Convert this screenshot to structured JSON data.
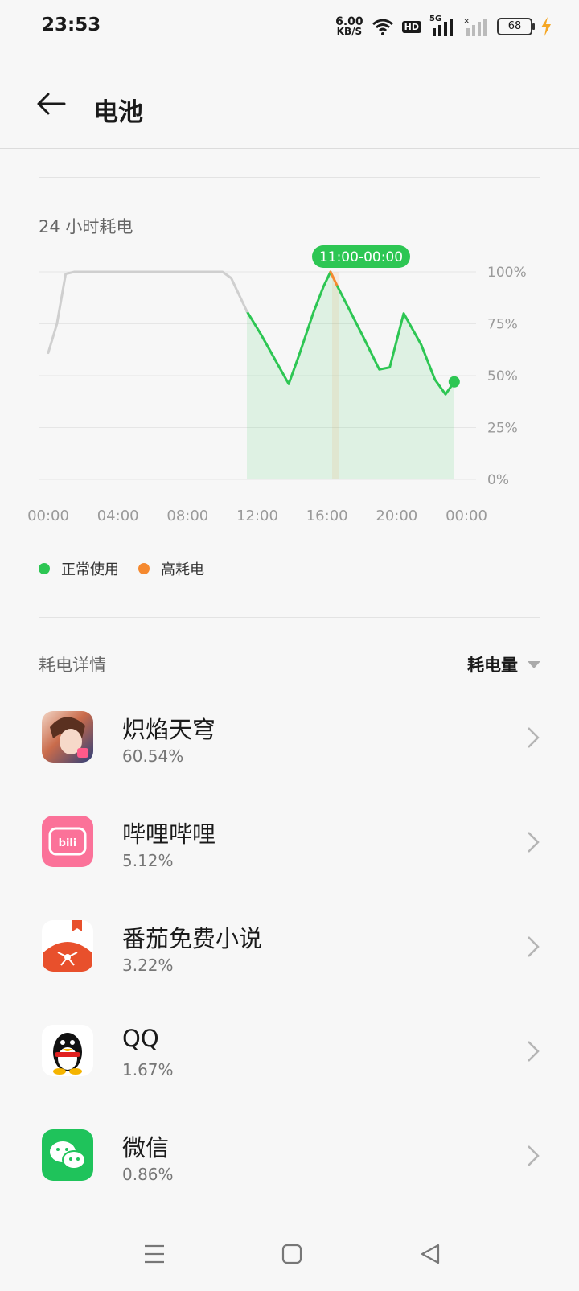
{
  "status_bar": {
    "time": "23:53",
    "net_speed_value": "6.00",
    "net_speed_unit": "KB/S",
    "hd_badge": "HD",
    "signal_label": "5G",
    "battery_level": "68"
  },
  "header": {
    "title": "电池"
  },
  "usage_section": {
    "title": "24 小时耗电",
    "selected_range": "11:00-00:00"
  },
  "chart_data": {
    "type": "line",
    "title": "24 小时耗电",
    "x_tick_labels": [
      "00:00",
      "04:00",
      "08:00",
      "12:00",
      "16:00",
      "20:00",
      "00:00"
    ],
    "y_tick_labels": [
      "100%",
      "75%",
      "50%",
      "25%",
      "0%"
    ],
    "ylim": [
      0,
      100
    ],
    "x_unit": "hours",
    "xlim": [
      0,
      24
    ],
    "grid": true,
    "series": [
      {
        "name": "正常使用",
        "color": "#2dc653",
        "x": [
          11.4,
          12.2,
          13.2,
          13.8,
          14.4,
          15.2,
          15.8,
          16.2
        ],
        "y": [
          81,
          70,
          55,
          46,
          60,
          80,
          93,
          100
        ]
      },
      {
        "name": "高耗电",
        "color": "#f5892f",
        "x": [
          16.2,
          16.6
        ],
        "y": [
          100,
          93
        ]
      },
      {
        "name": "正常使用",
        "color": "#2dc653",
        "x": [
          16.6,
          18.0,
          19.0,
          19.6,
          20.4,
          21.4,
          22.2,
          22.8,
          23.3
        ],
        "y": [
          93,
          70,
          53,
          54,
          80,
          65,
          48,
          41,
          47
        ]
      },
      {
        "name": "",
        "color": "#cfcfcf",
        "x": [
          0.0,
          0.5,
          1.0,
          1.5,
          2.0,
          8.0,
          9.0,
          10.0,
          10.5,
          11.4
        ],
        "y": [
          61,
          75,
          99,
          100,
          100,
          100,
          100,
          100,
          97,
          81
        ]
      }
    ]
  },
  "legend": [
    {
      "label": "正常使用",
      "color": "#2dc653"
    },
    {
      "label": "高耗电",
      "color": "#f5892f"
    }
  ],
  "details": {
    "title": "耗电详情",
    "sort_label": "耗电量",
    "apps": [
      {
        "name": "炽焰天穹",
        "percent": "60.54%"
      },
      {
        "name": "哔哩哔哩",
        "percent": "5.12%"
      },
      {
        "name": "番茄免费小说",
        "percent": "3.22%"
      },
      {
        "name": "QQ",
        "percent": "1.67%"
      },
      {
        "name": "微信",
        "percent": "0.86%"
      }
    ]
  },
  "icons": {
    "back": "back-arrow-icon",
    "wifi": "wifi-icon",
    "signal": "signal-icon",
    "battery": "battery-icon",
    "charging": "charging-bolt-icon",
    "chevron": "chevron-right-icon",
    "nav_menu": "menu-icon",
    "nav_home": "home-icon",
    "nav_back": "back-triangle-icon"
  }
}
